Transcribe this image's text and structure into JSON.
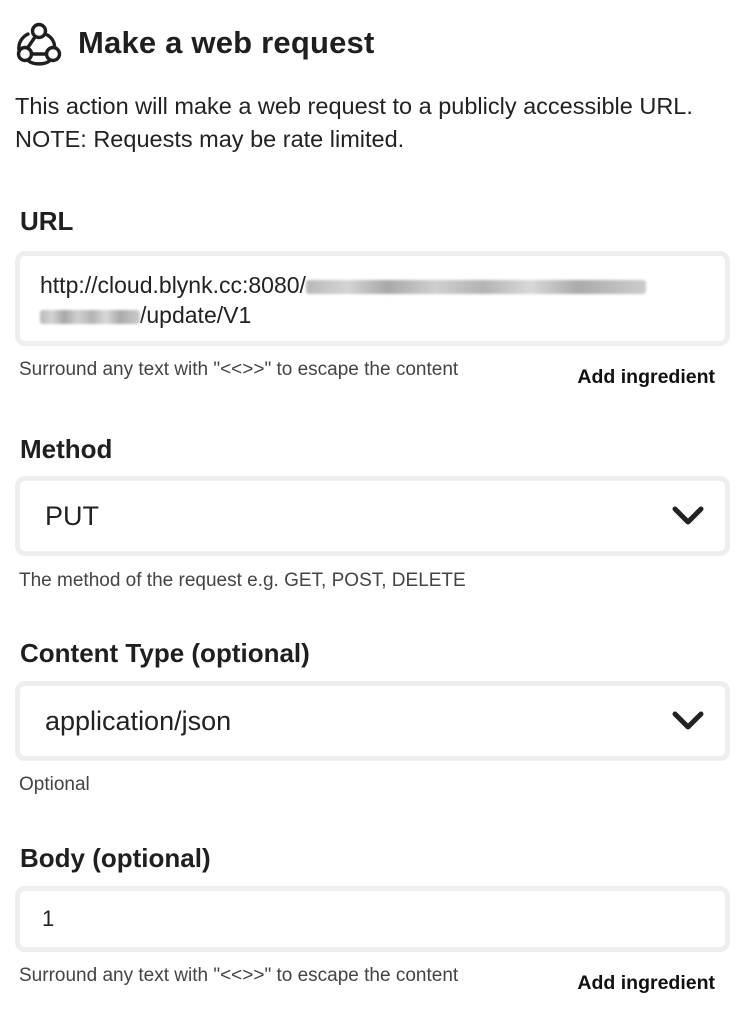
{
  "header": {
    "icon": "webhook-icon",
    "title": "Make a web request"
  },
  "description": {
    "line1": "This action will make a web request to a publicly accessible URL.",
    "line2": "NOTE: Requests may be rate limited."
  },
  "url": {
    "label": "URL",
    "value_visible_start": "http://cloud.blynk.cc:8080/",
    "value_visible_end": "/update/V1",
    "helper": "Surround any text with \"<<>>\" to escape the content",
    "add_ingredient": "Add ingredient"
  },
  "method": {
    "label": "Method",
    "value": "PUT",
    "helper": "The method of the request e.g. GET, POST, DELETE",
    "icon": "chevron-down-icon"
  },
  "content_type": {
    "label": "Content Type (optional)",
    "value": "application/json",
    "helper": "Optional",
    "icon": "chevron-down-icon"
  },
  "body": {
    "label": "Body (optional)",
    "value": "1",
    "helper": "Surround any text with \"<<>>\" to escape the content",
    "add_ingredient": "Add ingredient"
  }
}
